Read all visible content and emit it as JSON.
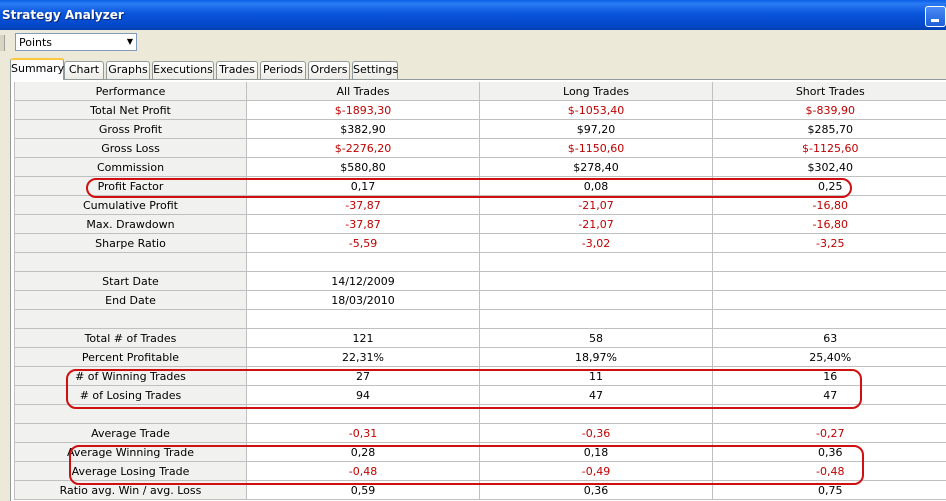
{
  "window": {
    "title": "Strategy Analyzer"
  },
  "toolbar": {
    "display_unit": "Points"
  },
  "tabs": [
    "Summary",
    "Chart",
    "Graphs",
    "Executions",
    "Trades",
    "Periods",
    "Orders",
    "Settings"
  ],
  "active_tab": "Summary",
  "table": {
    "columns": [
      "Performance",
      "All Trades",
      "Long Trades",
      "Short Trades"
    ],
    "rows": [
      {
        "label": "Total Net Profit",
        "values": [
          "$-1893,30",
          "$-1053,40",
          "$-839,90"
        ],
        "negative": true
      },
      {
        "label": "Gross Profit",
        "values": [
          "$382,90",
          "$97,20",
          "$285,70"
        ],
        "negative": false
      },
      {
        "label": "Gross Loss",
        "values": [
          "$-2276,20",
          "$-1150,60",
          "$-1125,60"
        ],
        "negative": true
      },
      {
        "label": "Commission",
        "values": [
          "$580,80",
          "$278,40",
          "$302,40"
        ],
        "negative": false
      },
      {
        "label": "Profit Factor",
        "values": [
          "0,17",
          "0,08",
          "0,25"
        ],
        "negative": false
      },
      {
        "label": "Cumulative Profit",
        "values": [
          "-37,87",
          "-21,07",
          "-16,80"
        ],
        "negative": true
      },
      {
        "label": "Max. Drawdown",
        "values": [
          "-37,87",
          "-21,07",
          "-16,80"
        ],
        "negative": true
      },
      {
        "label": "Sharpe Ratio",
        "values": [
          "-5,59",
          "-3,02",
          "-3,25"
        ],
        "negative": true
      },
      {
        "label": "",
        "values": [
          "",
          "",
          ""
        ],
        "negative": false
      },
      {
        "label": "Start Date",
        "values": [
          "14/12/2009",
          "",
          ""
        ],
        "negative": false
      },
      {
        "label": "End Date",
        "values": [
          "18/03/2010",
          "",
          ""
        ],
        "negative": false
      },
      {
        "label": "",
        "values": [
          "",
          "",
          ""
        ],
        "negative": false
      },
      {
        "label": "Total # of Trades",
        "values": [
          "121",
          "58",
          "63"
        ],
        "negative": false
      },
      {
        "label": "Percent Profitable",
        "values": [
          "22,31%",
          "18,97%",
          "25,40%"
        ],
        "negative": false
      },
      {
        "label": "# of Winning Trades",
        "values": [
          "27",
          "11",
          "16"
        ],
        "negative": false
      },
      {
        "label": "# of Losing Trades",
        "values": [
          "94",
          "47",
          "47"
        ],
        "negative": false
      },
      {
        "label": "",
        "values": [
          "",
          "",
          ""
        ],
        "negative": false
      },
      {
        "label": "Average Trade",
        "values": [
          "-0,31",
          "-0,36",
          "-0,27"
        ],
        "negative": true
      },
      {
        "label": "Average Winning Trade",
        "values": [
          "0,28",
          "0,18",
          "0,36"
        ],
        "negative": false
      },
      {
        "label": "Average Losing Trade",
        "values": [
          "-0,48",
          "-0,49",
          "-0,48"
        ],
        "negative": true
      },
      {
        "label": "Ratio avg. Win / avg. Loss",
        "values": [
          "0,59",
          "0,36",
          "0,75"
        ],
        "negative": false
      }
    ]
  },
  "colors": {
    "negative_text": "#c00000",
    "highlight": "#d01010",
    "titlebar": "#0a55dc"
  }
}
